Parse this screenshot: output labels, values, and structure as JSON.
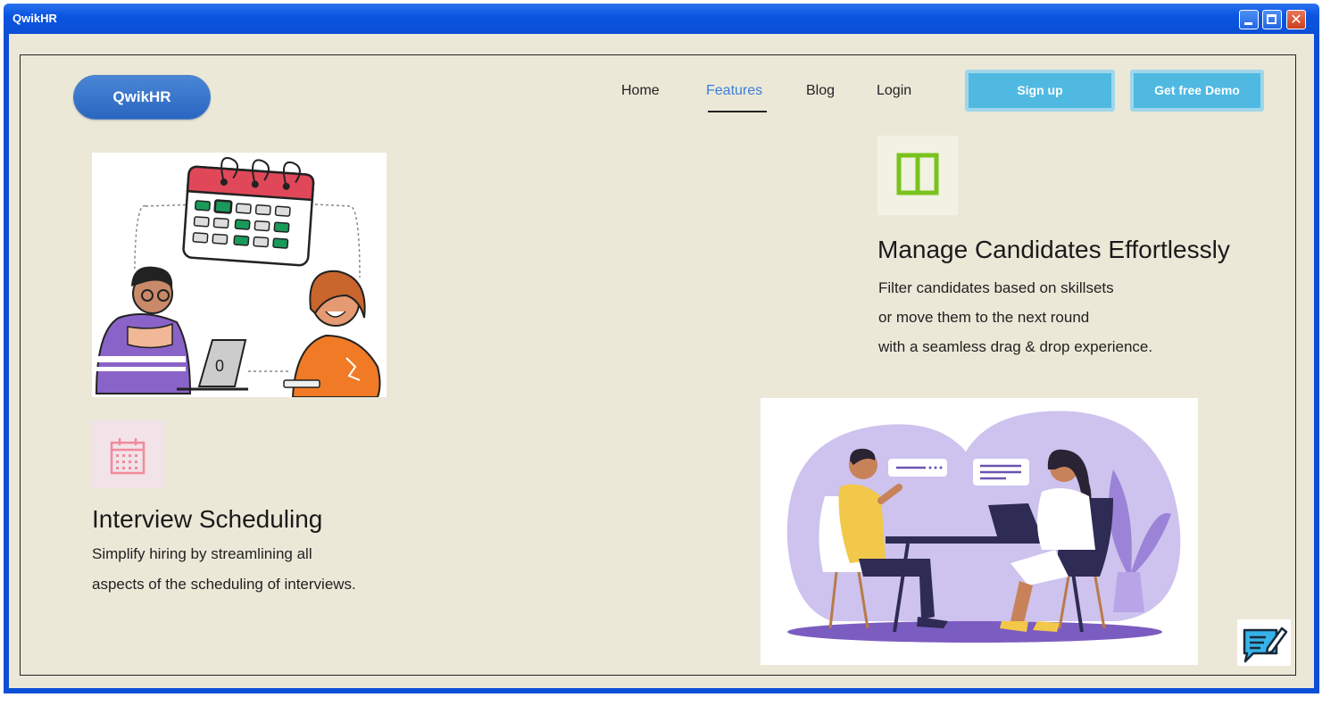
{
  "window": {
    "title": "QwikHR"
  },
  "nav": {
    "logo": "QwikHR",
    "links": [
      "Home",
      "Features",
      "Blog",
      "Login"
    ],
    "active": "Features",
    "signup": "Sign up",
    "demo": "Get free Demo"
  },
  "features": [
    {
      "title": "Manage Candidates Effortlessly",
      "lines": [
        "Filter candidates based on skillsets",
        "or move them to the next round",
        "with a seamless drag & drop experience."
      ],
      "icon": "columns-icon",
      "color": "#7ac21c"
    },
    {
      "title": "Interview Scheduling",
      "lines": [
        "Simplify hiring by streamlining all",
        "aspects of the scheduling of interviews."
      ],
      "icon": "calendar-icon",
      "color": "#f28a9b"
    }
  ],
  "colors": {
    "titlebar": "#0a4fd6",
    "background": "#ece8d8",
    "accent": "#3a7fd6",
    "cta": "#4fb9e2"
  }
}
